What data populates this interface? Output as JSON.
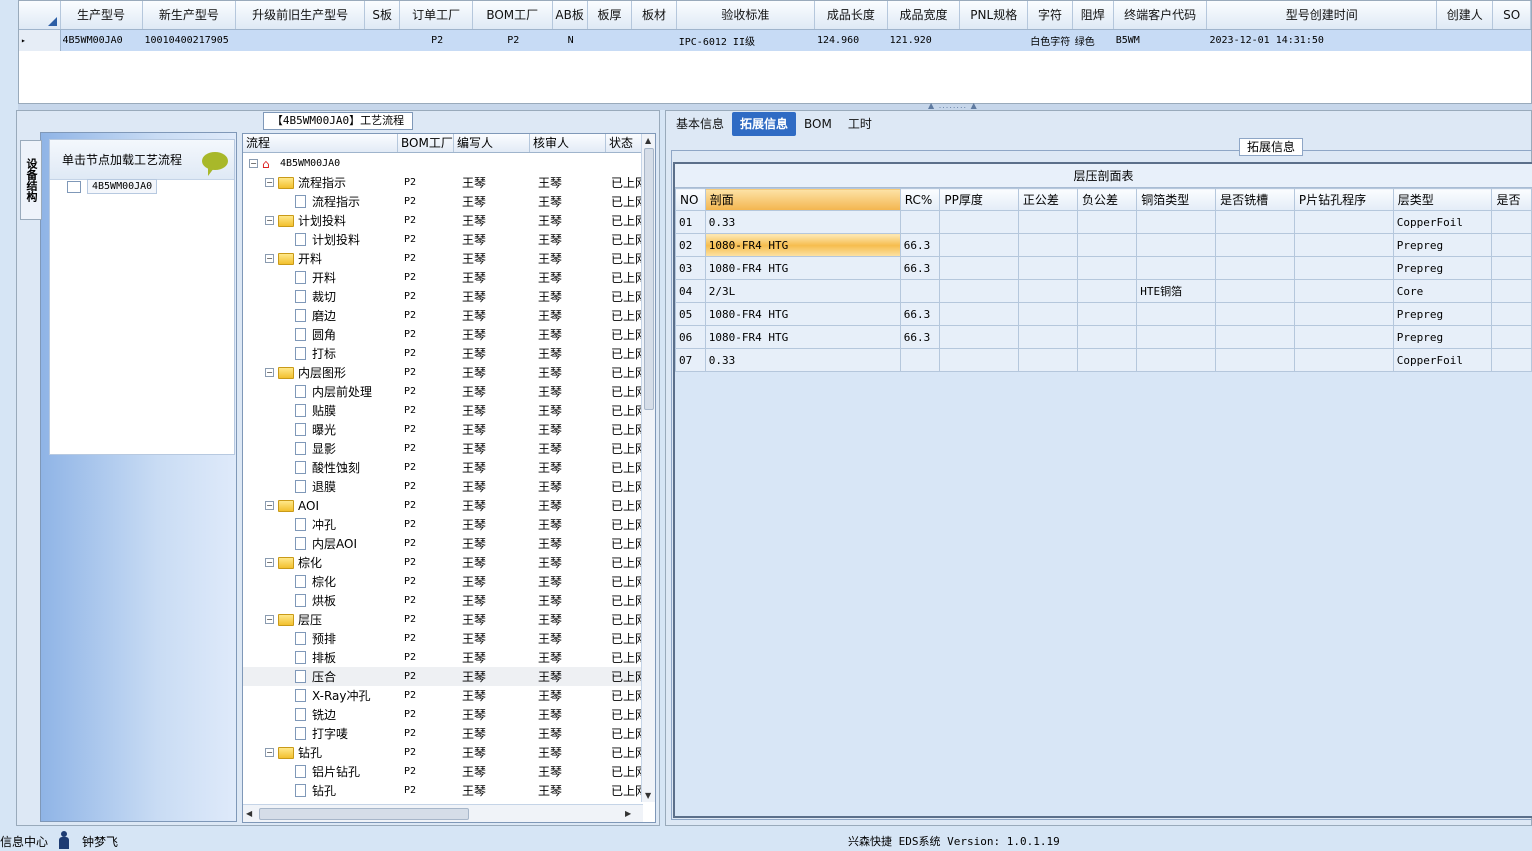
{
  "top_grid": {
    "columns": [
      "生产型号",
      "新生产型号",
      "升级前旧生产型号",
      "S板",
      "订单工厂",
      "BOM工厂",
      "AB板",
      "板厚",
      "板材",
      "验收标准",
      "成品长度",
      "成品宽度",
      "PNL规格",
      "字符",
      "阻焊",
      "终端客户代码",
      "型号创建时间",
      "创建人",
      "SO"
    ],
    "row": [
      "4B5WM00JA0",
      "10010400217905",
      "",
      "",
      "P2",
      "P2",
      "N",
      "",
      "",
      "IPC-6012 II级",
      "124.960",
      "121.920",
      "",
      "白色字符",
      "绿色",
      "B5WM",
      "2023-12-01 14:31:50",
      "",
      ""
    ]
  },
  "left": {
    "title_tab": "【4B5WM00JA0】工艺流程",
    "side_tab": "设备结构",
    "nav_header": "单击节点加载工艺流程",
    "nav_node": "4B5WM00JA0",
    "tree_columns": [
      "流程",
      "BOM工厂",
      "编写人",
      "核审人",
      "状态"
    ],
    "tree_root": "4B5WM00JA0",
    "tree_rows": [
      {
        "label": "流程指示",
        "type": "folder",
        "bom": "P2",
        "writer": "王琴",
        "reviewer": "王琴",
        "status": "已上网"
      },
      {
        "label": "流程指示",
        "type": "leaf",
        "bom": "P2",
        "writer": "王琴",
        "reviewer": "王琴",
        "status": "已上网"
      },
      {
        "label": "计划投料",
        "type": "folder",
        "bom": "P2",
        "writer": "王琴",
        "reviewer": "王琴",
        "status": "已上网"
      },
      {
        "label": "计划投料",
        "type": "leaf",
        "bom": "P2",
        "writer": "王琴",
        "reviewer": "王琴",
        "status": "已上网"
      },
      {
        "label": "开料",
        "type": "folder",
        "bom": "P2",
        "writer": "王琴",
        "reviewer": "王琴",
        "status": "已上网"
      },
      {
        "label": "开料",
        "type": "leaf",
        "bom": "P2",
        "writer": "王琴",
        "reviewer": "王琴",
        "status": "已上网"
      },
      {
        "label": "裁切",
        "type": "leaf",
        "bom": "P2",
        "writer": "王琴",
        "reviewer": "王琴",
        "status": "已上网"
      },
      {
        "label": "磨边",
        "type": "leaf",
        "bom": "P2",
        "writer": "王琴",
        "reviewer": "王琴",
        "status": "已上网"
      },
      {
        "label": "圆角",
        "type": "leaf",
        "bom": "P2",
        "writer": "王琴",
        "reviewer": "王琴",
        "status": "已上网"
      },
      {
        "label": "打标",
        "type": "leaf",
        "bom": "P2",
        "writer": "王琴",
        "reviewer": "王琴",
        "status": "已上网"
      },
      {
        "label": "内层图形",
        "type": "folder",
        "bom": "P2",
        "writer": "王琴",
        "reviewer": "王琴",
        "status": "已上网"
      },
      {
        "label": "内层前处理",
        "type": "leaf",
        "bom": "P2",
        "writer": "王琴",
        "reviewer": "王琴",
        "status": "已上网"
      },
      {
        "label": "贴膜",
        "type": "leaf",
        "bom": "P2",
        "writer": "王琴",
        "reviewer": "王琴",
        "status": "已上网"
      },
      {
        "label": "曝光",
        "type": "leaf",
        "bom": "P2",
        "writer": "王琴",
        "reviewer": "王琴",
        "status": "已上网"
      },
      {
        "label": "显影",
        "type": "leaf",
        "bom": "P2",
        "writer": "王琴",
        "reviewer": "王琴",
        "status": "已上网"
      },
      {
        "label": "酸性蚀刻",
        "type": "leaf",
        "bom": "P2",
        "writer": "王琴",
        "reviewer": "王琴",
        "status": "已上网"
      },
      {
        "label": "退膜",
        "type": "leaf",
        "bom": "P2",
        "writer": "王琴",
        "reviewer": "王琴",
        "status": "已上网"
      },
      {
        "label": "AOI",
        "type": "folder",
        "bom": "P2",
        "writer": "王琴",
        "reviewer": "王琴",
        "status": "已上网"
      },
      {
        "label": "冲孔",
        "type": "leaf",
        "bom": "P2",
        "writer": "王琴",
        "reviewer": "王琴",
        "status": "已上网"
      },
      {
        "label": "内层AOI",
        "type": "leaf",
        "bom": "P2",
        "writer": "王琴",
        "reviewer": "王琴",
        "status": "已上网"
      },
      {
        "label": "棕化",
        "type": "folder",
        "bom": "P2",
        "writer": "王琴",
        "reviewer": "王琴",
        "status": "已上网"
      },
      {
        "label": "棕化",
        "type": "leaf",
        "bom": "P2",
        "writer": "王琴",
        "reviewer": "王琴",
        "status": "已上网"
      },
      {
        "label": "烘板",
        "type": "leaf",
        "bom": "P2",
        "writer": "王琴",
        "reviewer": "王琴",
        "status": "已上网"
      },
      {
        "label": "层压",
        "type": "folder",
        "bom": "P2",
        "writer": "王琴",
        "reviewer": "王琴",
        "status": "已上网"
      },
      {
        "label": "预排",
        "type": "leaf",
        "bom": "P2",
        "writer": "王琴",
        "reviewer": "王琴",
        "status": "已上网"
      },
      {
        "label": "排板",
        "type": "leaf",
        "bom": "P2",
        "writer": "王琴",
        "reviewer": "王琴",
        "status": "已上网"
      },
      {
        "label": "压合",
        "type": "leaf",
        "bom": "P2",
        "writer": "王琴",
        "reviewer": "王琴",
        "status": "已上网",
        "selected": true
      },
      {
        "label": "X-Ray冲孔",
        "type": "leaf",
        "bom": "P2",
        "writer": "王琴",
        "reviewer": "王琴",
        "status": "已上网"
      },
      {
        "label": "铣边",
        "type": "leaf",
        "bom": "P2",
        "writer": "王琴",
        "reviewer": "王琴",
        "status": "已上网"
      },
      {
        "label": "打字唛",
        "type": "leaf",
        "bom": "P2",
        "writer": "王琴",
        "reviewer": "王琴",
        "status": "已上网"
      },
      {
        "label": "钻孔",
        "type": "folder",
        "bom": "P2",
        "writer": "王琴",
        "reviewer": "王琴",
        "status": "已上网"
      },
      {
        "label": "铝片钻孔",
        "type": "leaf",
        "bom": "P2",
        "writer": "王琴",
        "reviewer": "王琴",
        "status": "已上网"
      },
      {
        "label": "钻孔",
        "type": "leaf",
        "bom": "P2",
        "writer": "王琴",
        "reviewer": "王琴",
        "status": "已上网"
      }
    ]
  },
  "right": {
    "tabs": [
      "基本信息",
      "拓展信息",
      "BOM",
      "工时"
    ],
    "active_tab": "拓展信息",
    "group_title": "拓展信息",
    "stack_title": "层压剖面表",
    "stack_columns": [
      "NO",
      "剖面",
      "RC%",
      "PP厚度",
      "正公差",
      "负公差",
      "铜箔类型",
      "是否铣槽",
      "P片钻孔程序",
      "层类型",
      "是否"
    ],
    "stack_rows": [
      [
        "01",
        "0.33",
        "",
        "",
        "",
        "",
        "",
        "",
        "",
        "CopperFoil",
        ""
      ],
      [
        "02",
        "1080-FR4 HTG",
        "66.3",
        "",
        "",
        "",
        "",
        "",
        "",
        "Prepreg",
        ""
      ],
      [
        "03",
        "1080-FR4 HTG",
        "66.3",
        "",
        "",
        "",
        "",
        "",
        "",
        "Prepreg",
        ""
      ],
      [
        "04",
        "2/3L",
        "",
        "",
        "",
        "",
        "HTE铜箔",
        "",
        "",
        "Core",
        ""
      ],
      [
        "05",
        "1080-FR4 HTG",
        "66.3",
        "",
        "",
        "",
        "",
        "",
        "",
        "Prepreg",
        ""
      ],
      [
        "06",
        "1080-FR4 HTG",
        "66.3",
        "",
        "",
        "",
        "",
        "",
        "",
        "Prepreg",
        ""
      ],
      [
        "07",
        "0.33",
        "",
        "",
        "",
        "",
        "",
        "",
        "",
        "CopperFoil",
        ""
      ]
    ]
  },
  "status": {
    "left_text": "信息中心",
    "user": "钟梦飞",
    "version": "兴森快捷 EDS系统 Version: 1.0.1.19"
  },
  "colors": {
    "accent": "#2f6bc4",
    "highlight": "#f6bd4e",
    "selection": "#c7dbf5"
  }
}
